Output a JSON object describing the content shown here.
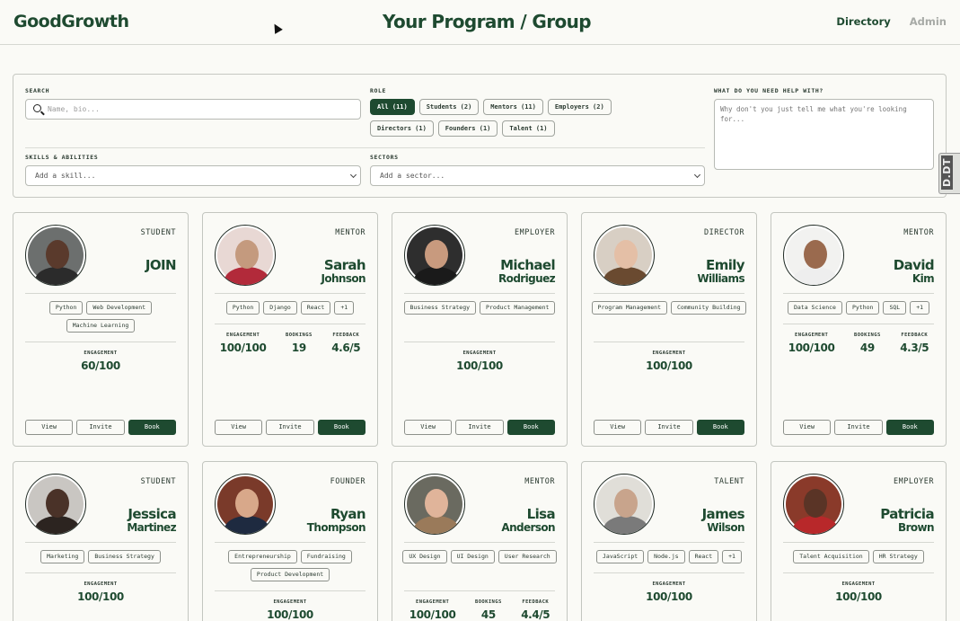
{
  "header": {
    "logo": "GoodGrowth",
    "title": "Your Program / Group",
    "nav": [
      {
        "label": "Directory"
      },
      {
        "label": "Admin"
      }
    ]
  },
  "filters": {
    "search_label": "SEARCH",
    "search_placeholder": "Name, bio...",
    "role_label": "ROLE",
    "roles": [
      "All (11)",
      "Students (2)",
      "Mentors (11)",
      "Employers (2)",
      "Directors (1)",
      "Founders (1)",
      "Talent (1)"
    ],
    "help_label": "WHAT DO YOU NEED HELP WITH?",
    "help_placeholder": "Why don't you just tell me what you're looking for...",
    "skills_label": "SKILLS & ABILITIES",
    "skills_placeholder": "Add a skill...",
    "sectors_label": "SECTORS",
    "sectors_placeholder": "Add a sector..."
  },
  "side_tab": "D.DT",
  "buttons": {
    "view": "View",
    "invite": "Invite",
    "book": "Book"
  },
  "cards": [
    {
      "role": "STUDENT",
      "first": "JOIN",
      "last": "",
      "tags": [
        "Python",
        "Web Development",
        "Machine Learning"
      ],
      "stats": [
        {
          "label": "ENGAGEMENT",
          "value": "60/100"
        }
      ],
      "colors": {
        "bg": "#6c6f6e",
        "face": "#5a3a2c",
        "body": "#2b2b2b"
      }
    },
    {
      "role": "MENTOR",
      "first": "Sarah",
      "last": "Johnson",
      "tags": [
        "Python",
        "Django",
        "React",
        "+1"
      ],
      "stats": [
        {
          "label": "ENGAGEMENT",
          "value": "100/100"
        },
        {
          "label": "BOOKINGS",
          "value": "19"
        },
        {
          "label": "FEEDBACK",
          "value": "4.6/5"
        }
      ],
      "colors": {
        "bg": "#e8d8d4",
        "face": "#c49a7e",
        "body": "#b22a3a"
      }
    },
    {
      "role": "EMPLOYER",
      "first": "Michael",
      "last": "Rodriguez",
      "tags": [
        "Business Strategy",
        "Product Management"
      ],
      "stats": [
        {
          "label": "ENGAGEMENT",
          "value": "100/100"
        }
      ],
      "colors": {
        "bg": "#2e2e2e",
        "face": "#c89a7e",
        "body": "#1a1a1a"
      }
    },
    {
      "role": "DIRECTOR",
      "first": "Emily",
      "last": "Williams",
      "tags": [
        "Program Management",
        "Community Building"
      ],
      "stats": [
        {
          "label": "ENGAGEMENT",
          "value": "100/100"
        }
      ],
      "colors": {
        "bg": "#d8cfc4",
        "face": "#e4bfa6",
        "body": "#6a4a30"
      }
    },
    {
      "role": "MENTOR",
      "first": "David",
      "last": "Kim",
      "tags": [
        "Data Science",
        "Python",
        "SQL",
        "+1"
      ],
      "stats": [
        {
          "label": "ENGAGEMENT",
          "value": "100/100"
        },
        {
          "label": "BOOKINGS",
          "value": "49"
        },
        {
          "label": "FEEDBACK",
          "value": "4.3/5"
        }
      ],
      "colors": {
        "bg": "#f2f2f0",
        "face": "#9a6a4e",
        "body": "#eeeeee"
      }
    },
    {
      "role": "STUDENT",
      "first": "Jessica",
      "last": "Martinez",
      "tags": [
        "Marketing",
        "Business Strategy"
      ],
      "stats": [
        {
          "label": "ENGAGEMENT",
          "value": "100/100"
        }
      ],
      "colors": {
        "bg": "#c9c6c2",
        "face": "#4a3228",
        "body": "#2c2420"
      }
    },
    {
      "role": "FOUNDER",
      "first": "Ryan",
      "last": "Thompson",
      "tags": [
        "Entrepreneurship",
        "Fundraising",
        "Product Development"
      ],
      "stats": [
        {
          "label": "ENGAGEMENT",
          "value": "100/100"
        }
      ],
      "colors": {
        "bg": "#7a3a2a",
        "face": "#d8a88a",
        "body": "#1e2a40"
      }
    },
    {
      "role": "MENTOR",
      "first": "Lisa",
      "last": "Anderson",
      "tags": [
        "UX Design",
        "UI Design",
        "User Research"
      ],
      "stats": [
        {
          "label": "ENGAGEMENT",
          "value": "100/100"
        },
        {
          "label": "BOOKINGS",
          "value": "45"
        },
        {
          "label": "FEEDBACK",
          "value": "4.4/5"
        }
      ],
      "colors": {
        "bg": "#6a6a60",
        "face": "#e0b49a",
        "body": "#9a7a5a"
      }
    },
    {
      "role": "TALENT",
      "first": "James",
      "last": "Wilson",
      "tags": [
        "JavaScript",
        "Node.js",
        "React",
        "+1"
      ],
      "stats": [
        {
          "label": "ENGAGEMENT",
          "value": "100/100"
        }
      ],
      "colors": {
        "bg": "#e0ded8",
        "face": "#c8a48c",
        "body": "#7a7a7a"
      }
    },
    {
      "role": "EMPLOYER",
      "first": "Patricia",
      "last": "Brown",
      "tags": [
        "Talent Acquisition",
        "HR Strategy"
      ],
      "stats": [
        {
          "label": "ENGAGEMENT",
          "value": "100/100"
        }
      ],
      "colors": {
        "bg": "#8a3a2a",
        "face": "#5a3426",
        "body": "#b8282a"
      }
    }
  ]
}
